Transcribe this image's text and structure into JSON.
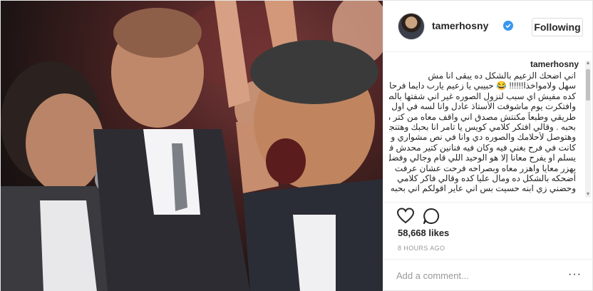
{
  "post": {
    "photo_alt": "Tamer Hosny with microphone, laughing crowd",
    "header": {
      "username": "tamerhosny",
      "verified_icon": "verified-badge-icon",
      "follow_label": "Following"
    },
    "caption": {
      "username": "tamerhosny",
      "lines": [
        "اني اضحك الزعيم بالشكل ده يبقى انا مش",
        "سهل ولامواخذا!!!!!! 😂 حبيبي يا زعيم يارب دايما فرحان",
        "كده مفيش اي سبب لنزول الصوره غير اني شفتها بالصدفه.",
        "وافتكرت يوم ماشوفت الأستاذ عادل وانا لسه في اول",
        "طريقي وطبعاً مكنتش مصدق اني واقف معاه من كتر ما",
        "بحبه . وقالي افتكر كلامي كويس يا تامر انا بحبك وهتنجح",
        "وهتوصل لأحلامك والصوره دي وانا في نص مشواري و",
        "كانت في فرح بغني فيه وكان فيه فنانين كتير محدش فيهم قام",
        "يسلم او يفرح معانا إلا هو الوحيد اللي قام وجالي وفضل",
        "يهزر معايا واهزر معاه وبصراحه فرحت عشان عرفت",
        "أضحكه بالشكل ده ومال عليا كده وقالي فاكر كلامي",
        "وحضني زي ابنه حسيت بس اني عاير اقولكم اني بحبه جداً"
      ]
    },
    "actions": {
      "like_icon": "heart-icon",
      "comment_icon": "comment-bubble-icon"
    },
    "likes_text": "58,668 likes",
    "timestamp": "8 HOURS AGO",
    "comment": {
      "placeholder": "Add a comment...",
      "more_label": "···"
    },
    "colors": {
      "verified_blue": "#3897f0",
      "border": "#efefef",
      "muted_text": "#999999"
    }
  }
}
